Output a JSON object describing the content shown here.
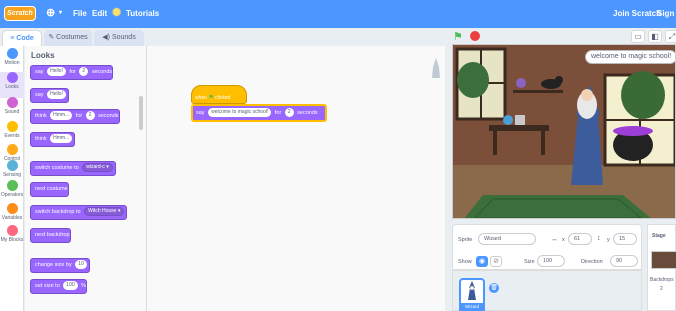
{
  "menubar": {
    "logo": "Scratch",
    "file": "File",
    "edit": "Edit",
    "tutorials": "Tutorials",
    "join": "Join Scratch",
    "sign": "Sign"
  },
  "tabs": {
    "code": "Code",
    "costumes": "Costumes",
    "sounds": "Sounds"
  },
  "categories": [
    {
      "label": "Motion",
      "color": "#4c97ff"
    },
    {
      "label": "Looks",
      "color": "#9966ff"
    },
    {
      "label": "Sound",
      "color": "#cf63cf"
    },
    {
      "label": "Events",
      "color": "#ffbf00"
    },
    {
      "label": "Control",
      "color": "#ffab19"
    },
    {
      "label": "Sensing",
      "color": "#5cb1d6"
    },
    {
      "label": "Operators",
      "color": "#59c059"
    },
    {
      "label": "Variables",
      "color": "#ff8c1a"
    },
    {
      "label": "My Blocks",
      "color": "#ff6680"
    }
  ],
  "palette": {
    "title": "Looks",
    "say_for": {
      "say": "say",
      "text": "Hello!",
      "for": "for",
      "secs": "2",
      "seconds": "seconds"
    },
    "say": {
      "say": "say",
      "text": "Hello!"
    },
    "think_for": {
      "think": "think",
      "text": "Hmm...",
      "for": "for",
      "secs": "2",
      "seconds": "seconds"
    },
    "think": {
      "think": "think",
      "text": "Hmm..."
    },
    "switch_costume": {
      "label": "switch costume to",
      "value": "wizard-c"
    },
    "next_costume": "next costume",
    "switch_backdrop": {
      "label": "switch backdrop to",
      "value": "Witch House"
    },
    "next_backdrop": "next backdrop",
    "change_size": {
      "label": "change size by",
      "value": "10"
    },
    "set_size": {
      "label": "set size to",
      "value": "100",
      "unit": "%"
    }
  },
  "script": {
    "hat": {
      "when": "when",
      "clicked": "clicked"
    },
    "say": {
      "say": "say",
      "text": "welcome to magic school!",
      "for": "for",
      "secs": "2",
      "seconds": "seconds"
    }
  },
  "stage": {
    "speech": "welcome to magic school!"
  },
  "sprite_info": {
    "sprite_label": "Sprite",
    "sprite_name": "Wizard",
    "x_label": "x",
    "x": "61",
    "y_label": "y",
    "y": "15",
    "show_label": "Show",
    "size_label": "Size",
    "size": "100",
    "direction_label": "Direction",
    "direction": "90"
  },
  "sprites": [
    {
      "name": "Wizard"
    }
  ],
  "stage_pane": {
    "title": "Stage",
    "backdrops_label": "Backdrops",
    "backdrops_count": "2"
  }
}
